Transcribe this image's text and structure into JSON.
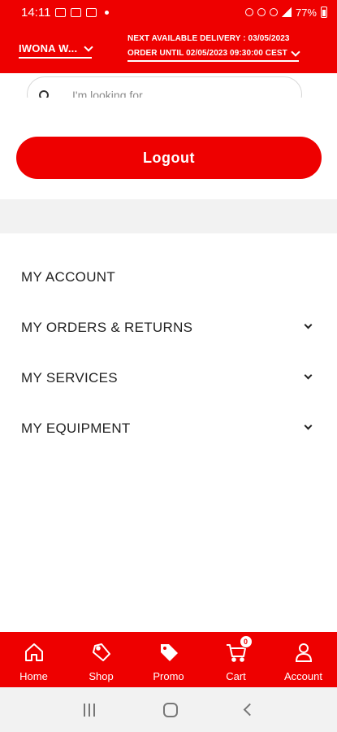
{
  "status_bar": {
    "time": "14:11",
    "battery": "77%"
  },
  "header": {
    "store_name": "IWONA W...",
    "delivery_line1": "NEXT AVAILABLE DELIVERY : 03/05/2023",
    "delivery_line2": "ORDER UNTIL 02/05/2023 09:30:00 CEST"
  },
  "search": {
    "placeholder": "I'm looking for"
  },
  "logout_label": "Logout",
  "menu": {
    "items": [
      {
        "label": "MY ACCOUNT",
        "expandable": false
      },
      {
        "label": "MY ORDERS & RETURNS",
        "expandable": true
      },
      {
        "label": "MY SERVICES",
        "expandable": true
      },
      {
        "label": "MY EQUIPMENT",
        "expandable": true
      }
    ]
  },
  "bottom_nav": {
    "items": [
      {
        "label": "Home",
        "icon": "home-icon"
      },
      {
        "label": "Shop",
        "icon": "tag-icon"
      },
      {
        "label": "Promo",
        "icon": "promo-tag-icon"
      },
      {
        "label": "Cart",
        "icon": "cart-icon"
      },
      {
        "label": "Account",
        "icon": "user-icon"
      }
    ],
    "cart_count": "0"
  },
  "colors": {
    "brand_red": "#ee0000",
    "background": "#ffffff",
    "gray_band": "#f2f2f2"
  }
}
